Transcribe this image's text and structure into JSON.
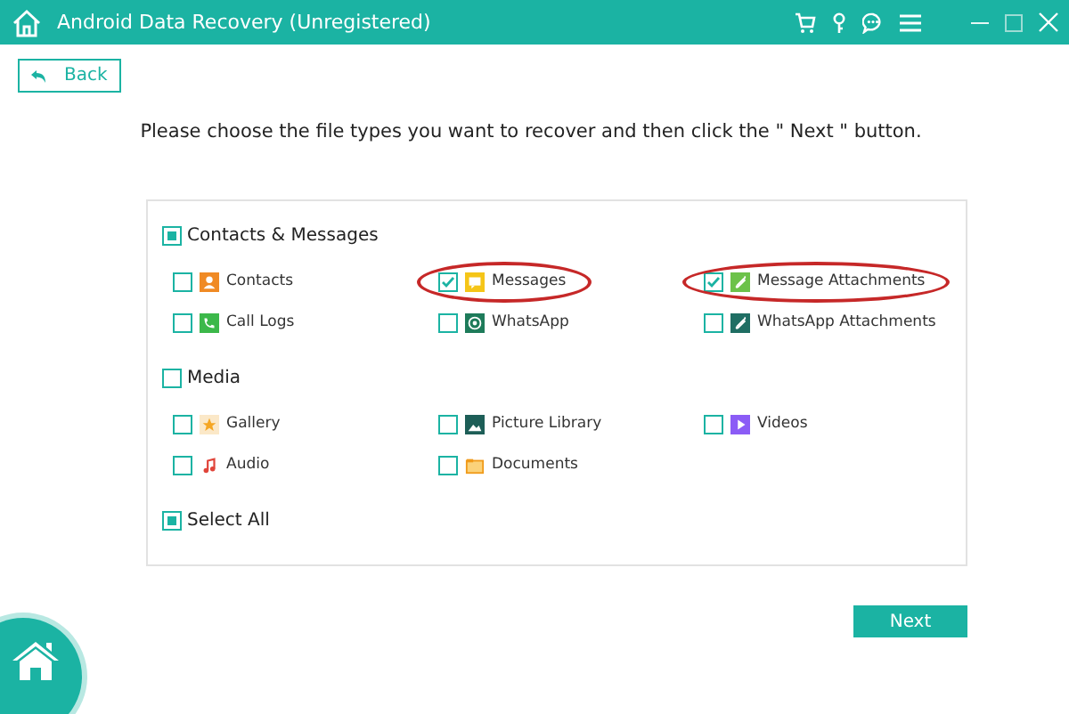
{
  "window": {
    "title": "Android Data Recovery (Unregistered)"
  },
  "back_button": {
    "label": "Back"
  },
  "instruction": "Please choose the file types you want to recover and then click the \" Next \" button.",
  "groups": [
    {
      "label": "Contacts & Messages",
      "indeterminate": true,
      "items": [
        {
          "label": "Contacts",
          "checked": false,
          "highlighted": false
        },
        {
          "label": "Messages",
          "checked": true,
          "highlighted": true
        },
        {
          "label": "Message Attachments",
          "checked": true,
          "highlighted": true
        },
        {
          "label": "Call Logs",
          "checked": false,
          "highlighted": false
        },
        {
          "label": "WhatsApp",
          "checked": false,
          "highlighted": false
        },
        {
          "label": "WhatsApp Attachments",
          "checked": false,
          "highlighted": false
        }
      ]
    },
    {
      "label": "Media",
      "indeterminate": false,
      "items": [
        {
          "label": "Gallery",
          "checked": false,
          "highlighted": false
        },
        {
          "label": "Picture Library",
          "checked": false,
          "highlighted": false
        },
        {
          "label": "Videos",
          "checked": false,
          "highlighted": false
        },
        {
          "label": "Audio",
          "checked": false,
          "highlighted": false
        },
        {
          "label": "Documents",
          "checked": false,
          "highlighted": false
        }
      ]
    }
  ],
  "select_all": {
    "label": "Select All",
    "indeterminate": true
  },
  "next_button": {
    "label": "Next"
  }
}
